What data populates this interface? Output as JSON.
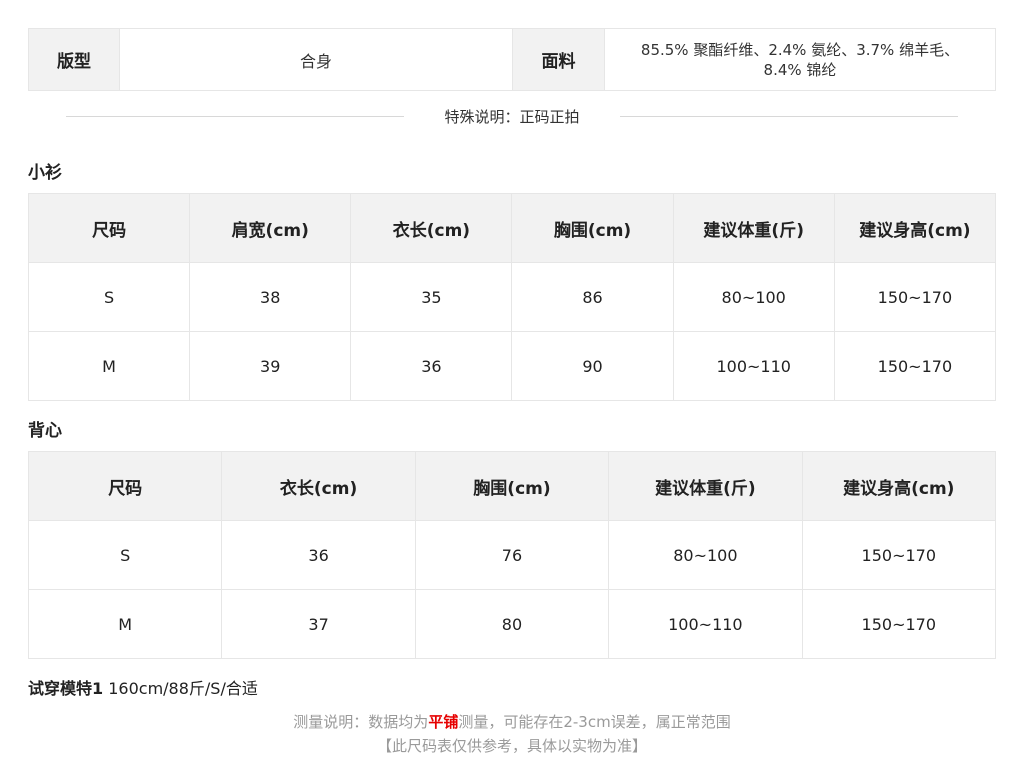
{
  "info": {
    "fit_label": "版型",
    "fit_value": "合身",
    "fabric_label": "面料",
    "fabric_line1": "85.5% 聚酯纤维、2.4% 氨纶、3.7% 绵羊毛、",
    "fabric_line2": "8.4% 锦纶"
  },
  "note": {
    "text": "特殊说明：正码正拍"
  },
  "table1": {
    "title": "小衫",
    "headers": [
      "尺码",
      "肩宽(cm)",
      "衣长(cm)",
      "胸围(cm)",
      "建议体重(斤)",
      "建议身高(cm)"
    ],
    "rows": [
      [
        "S",
        "38",
        "35",
        "86",
        "80~100",
        "150~170"
      ],
      [
        "M",
        "39",
        "36",
        "90",
        "100~110",
        "150~170"
      ]
    ]
  },
  "table2": {
    "title": "背心",
    "headers": [
      "尺码",
      "衣长(cm)",
      "胸围(cm)",
      "建议体重(斤)",
      "建议身高(cm)"
    ],
    "rows": [
      [
        "S",
        "36",
        "76",
        "80~100",
        "150~170"
      ],
      [
        "M",
        "37",
        "80",
        "100~110",
        "150~170"
      ]
    ]
  },
  "model": {
    "label": "试穿模特1",
    "value": " 160cm/88斤/S/合适"
  },
  "footer": {
    "pre": "测量说明：数据均为",
    "highlight": "平铺",
    "post": "测量，可能存在2-3cm误差，属正常范围",
    "line2": "【此尺码表仅供参考，具体以实物为准】",
    "highlight_color": "#e60000"
  }
}
